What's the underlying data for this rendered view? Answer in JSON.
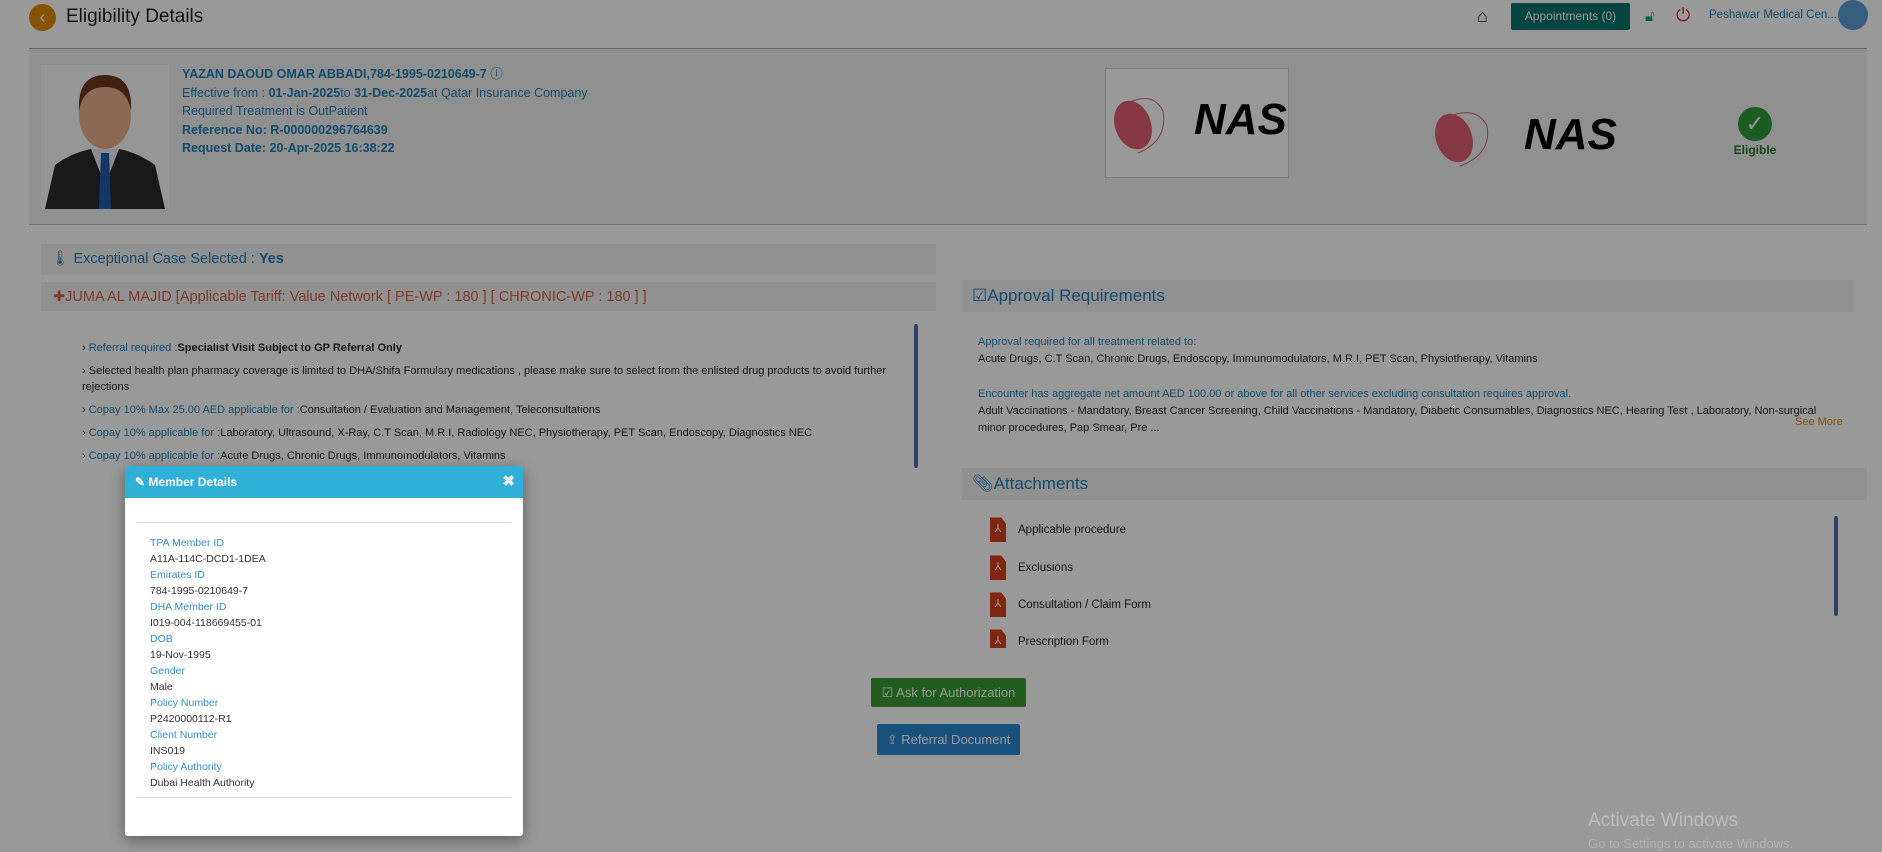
{
  "header": {
    "title": "Eligibility Details",
    "appointments_label": "Appointments (0)",
    "facility": "Peshawar Medical Cen..."
  },
  "patient": {
    "name_id": "YAZAN DAOUD OMAR ABBADI,784-1995-0210649-7",
    "effective_prefix": "Effective from : ",
    "effective_from": "01-Jan-2025",
    "to_word": "to ",
    "effective_to": "31-Dec-2025",
    "at_company": "at Qatar Insurance Company",
    "treatment": "Required Treatment is OutPatient",
    "reference": "Reference No: R-000000296764639",
    "request_date": "Request Date: 20-Apr-2025 16:38:22"
  },
  "logos": {
    "logo1": "NAS",
    "logo2": "NAS"
  },
  "status": {
    "label": "Eligible",
    "color": "#2e9c3a"
  },
  "exceptional": {
    "label": "Exceptional Case Selected : ",
    "value": "Yes"
  },
  "provider": {
    "label": "JUMA AL MAJID [Applicable Tariff: Value Network [ PE-WP : 180 ] [ CHRONIC-WP : 180 ] ]"
  },
  "benefits": [
    {
      "label": "Referral required :",
      "value": "Specialist Visit Subject to GP Referral Only",
      "bold": true
    },
    {
      "label": "",
      "value": "Selected health plan pharmacy coverage is limited to DHA/Shifa Formulary medications , please make sure to select from the enlisted drug products to avoid further rejections"
    },
    {
      "label": "Copay 10% Max 25.00 AED applicable for :",
      "value": "Consultation / Evaluation and Management, Teleconsultations"
    },
    {
      "label": "Copay 10% applicable for  :",
      "value": "Laboratory, Ultrasound, X-Ray, C.T Scan, M.R.I, Radiology NEC, Physiotherapy, PET Scan, Endoscopy, Diagnostics NEC"
    },
    {
      "label": "Copay 10% applicable for  :",
      "value": "Acute Drugs, Chronic Drugs, Immunomodulators, Vitamins"
    }
  ],
  "approval": {
    "title": "Approval Requirements",
    "req1_label": "Approval required for all treatment related to:",
    "req1_value": "Acute Drugs, C.T Scan, Chronic Drugs, Endoscopy, Immunomodulators, M.R.I, PET Scan, Physiotherapy, Vitamins",
    "req2_label": "Encounter has aggregate net amount AED 100.00 or above for all other services excluding consultation requires approval.",
    "req2_value": "Adult Vaccinations - Mandatory, Breast Cancer Screening, Child Vaccinations - Mandatory, Diabetic Consumables, Diagnostics NEC, Hearing Test , Laboratory, Non-surgical minor procedures, Pap Smear, Pre ...",
    "see_more": "See More"
  },
  "attachments": {
    "title": "Attachments",
    "items": [
      "Applicable procedure",
      "Exclusions",
      "Consultation / Claim Form",
      "Prescription Form"
    ]
  },
  "actions": {
    "ask_auth": "Ask for Authorization",
    "referral_doc": "Referral Document"
  },
  "modal": {
    "title": "Member Details",
    "fields": [
      {
        "k": "TPA Member ID",
        "v": "A11A-114C-DCD1-1DEA"
      },
      {
        "k": "Emirates ID",
        "v": "784-1995-0210649-7"
      },
      {
        "k": "DHA Member ID",
        "v": "I019-004-118669455-01"
      },
      {
        "k": "DOB",
        "v": "19-Nov-1995"
      },
      {
        "k": "Gender",
        "v": "Male"
      },
      {
        "k": "Policy Number",
        "v": "P2420000112-R1"
      },
      {
        "k": "Client Number",
        "v": "INS019"
      },
      {
        "k": "Policy Authority",
        "v": "Dubai Health Authority"
      }
    ]
  },
  "watermark": {
    "line1": "Activate Windows",
    "line2": "Go to Settings to activate Windows."
  }
}
